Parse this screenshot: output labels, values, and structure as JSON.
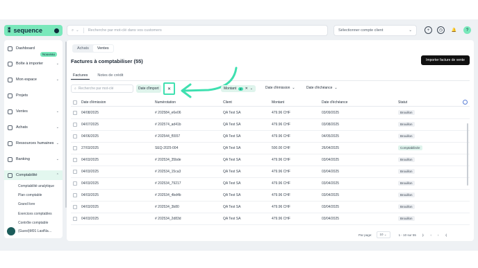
{
  "brand": {
    "name": "sequence",
    "mark": "⁑"
  },
  "topbar": {
    "search_placeholder": "Recherche par mot-clé dans vos customers",
    "client_select": "Sélectionner compte client"
  },
  "sidebar": {
    "items": [
      {
        "label": "Dashboard"
      },
      {
        "label": "Boîte à importer",
        "badge": "Nouveau"
      },
      {
        "label": "Mon espace"
      },
      {
        "label": "Projets"
      },
      {
        "label": "Ventes"
      },
      {
        "label": "Achats"
      },
      {
        "label": "Ressources humaines"
      },
      {
        "label": "Banking"
      },
      {
        "label": "Comptabilité"
      }
    ],
    "sub_items": [
      "Comptabilité analytique",
      "Plan comptable",
      "Grand livre",
      "Exercices comptables",
      "Contrôle comptable"
    ],
    "user": "(Guest)M91 LastNa…"
  },
  "main": {
    "toggle": [
      "Achats",
      "Ventes"
    ],
    "title": "Factures à comptabiliser (55)",
    "import_button": "Importer facture de vente",
    "tabs": [
      "Factures",
      "Notes de crédit"
    ],
    "filter_search_placeholder": "Recherche par mot-clé",
    "filters": {
      "import_date": "Date d'import",
      "montant": "Montant",
      "montant_count": "2",
      "emission": "Date d'émission",
      "echeance": "Date d'échéance"
    },
    "columns": [
      "Date d'émission",
      "Numérotation",
      "Client",
      "Montant",
      "Date d'échéance",
      "Statut"
    ],
    "rows": [
      [
        "04/08/2025",
        "# 202584_e6e06",
        "QA Test SA",
        "479.96 CHF",
        "03/09/2025",
        "Brouillon"
      ],
      [
        "04/07/2025",
        "# 202574_ad41b",
        "QA Test SA",
        "479.96 CHF",
        "03/08/2025",
        "Brouillon"
      ],
      [
        "04/06/2025",
        "# 202544_f5557",
        "QA Test SA",
        "479.96 CHF",
        "04/05/2025",
        "Brouillon"
      ],
      [
        "27/03/2025",
        "SEQ-2025-004",
        "QA Test SA",
        "500.00 CHF",
        "26/04/2025",
        "Comptabilisée"
      ],
      [
        "04/03/2025",
        "# 202534_35bde",
        "QA Test SA",
        "479.96 CHF",
        "03/04/2025",
        "Brouillon"
      ],
      [
        "04/03/2025",
        "# 202534_15ca3",
        "QA Test SA",
        "479.96 CHF",
        "03/04/2025",
        "Brouillon"
      ],
      [
        "04/03/2025",
        "# 202534_79217",
        "QA Test SA",
        "479.96 CHF",
        "03/04/2025",
        "Brouillon"
      ],
      [
        "04/03/2025",
        "# 202534_4bd4b",
        "QA Test SA",
        "479.96 CHF",
        "03/04/2025",
        "Brouillon"
      ],
      [
        "04/03/2025",
        "# 202534_3b80",
        "QA Test SA",
        "479.96 CHF",
        "03/04/2025",
        "Brouillon"
      ],
      [
        "04/03/2025",
        "# 202534_2d83d",
        "QA Test SA",
        "479.96 CHF",
        "03/04/2025",
        "Brouillon"
      ]
    ],
    "pager": {
      "label": "Par page:",
      "per_page": "10",
      "range": "1 - 10 sur 55"
    }
  },
  "colors": {
    "accent": "#79e8bb",
    "highlight": "#3fe0b0",
    "dark": "#111111"
  }
}
